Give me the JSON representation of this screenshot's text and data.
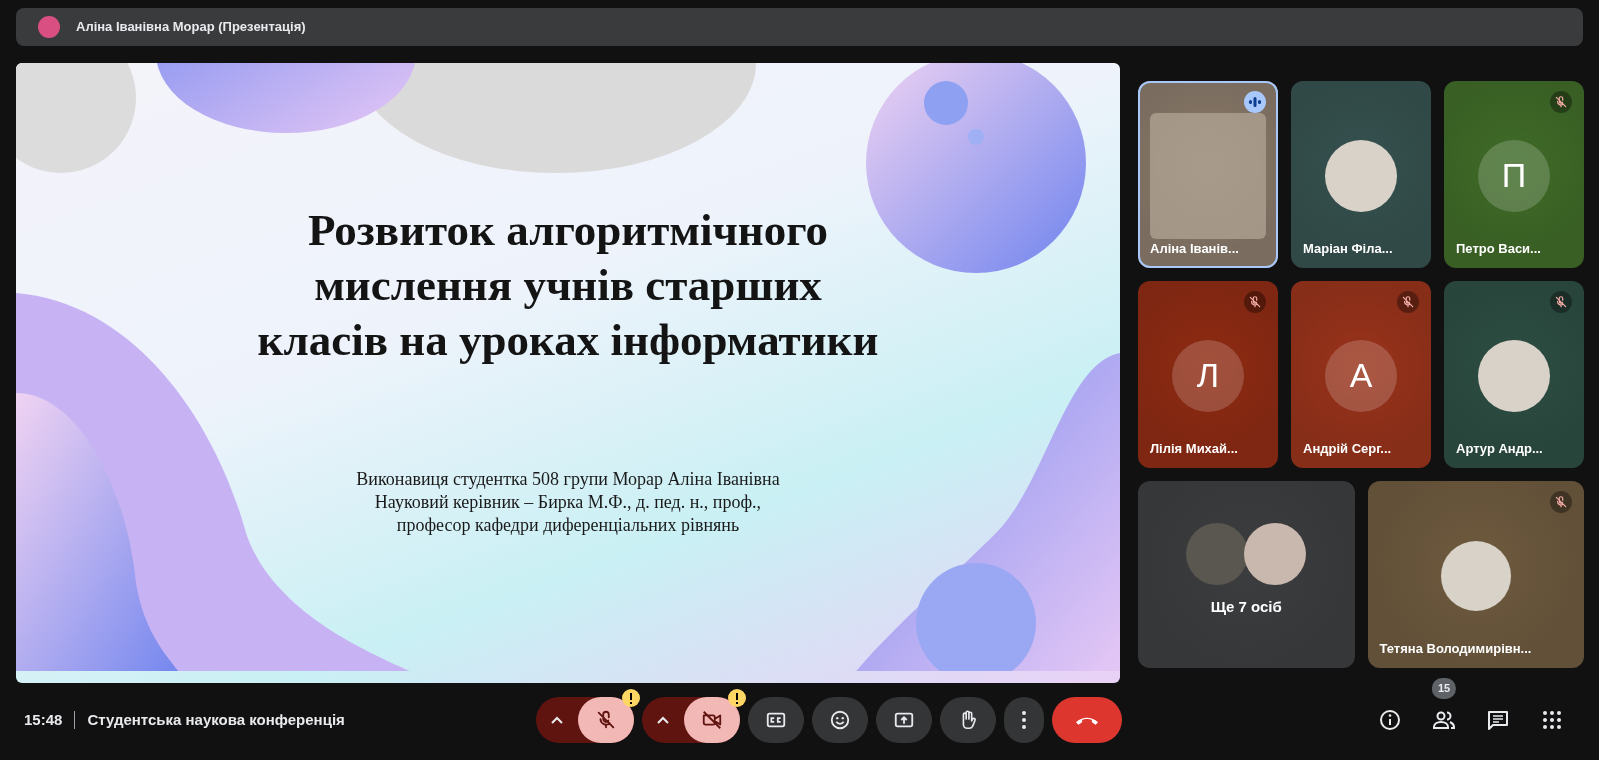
{
  "header": {
    "title": "Аліна Іванівна Морар (Презентація)"
  },
  "slide": {
    "title_lines": [
      "Розвиток алгоритмічного",
      "мислення учнів старших",
      "класів на уроках інформатики"
    ],
    "subtitle_lines": [
      "Виконавиця студентка 508 групи Морар Аліна Іванівна",
      "Науковий керівник – Бирка М.Ф., д. пед. н., проф.,",
      "професор кафедри диференціальних рівнянь"
    ]
  },
  "tiles": [
    {
      "kind": "video",
      "name": "Аліна Іванів...",
      "speaking": true,
      "muted": false,
      "color": "#8a7a6a"
    },
    {
      "kind": "photo",
      "name": "Маріан Філа...",
      "speaking": false,
      "muted": false,
      "color": "#35514f"
    },
    {
      "kind": "initial",
      "name": "Петро Васи...",
      "initial": "П",
      "speaking": false,
      "muted": true,
      "color": "#3f6b27"
    },
    {
      "kind": "initial",
      "name": "Лілія Михай...",
      "initial": "Л",
      "speaking": false,
      "muted": true,
      "color": "#8f2a12"
    },
    {
      "kind": "initial",
      "name": "Андрій Серг...",
      "initial": "А",
      "speaking": false,
      "muted": true,
      "color": "#99321a"
    },
    {
      "kind": "photo",
      "name": "Артур Андр...",
      "speaking": false,
      "muted": true,
      "color": "#2c4d42"
    },
    {
      "kind": "more",
      "name": "Ще 7 осіб",
      "speaking": false,
      "muted": false,
      "color": "#3c3d3f"
    },
    {
      "kind": "photo",
      "name": "Тетяна Володимирівн...",
      "speaking": false,
      "muted": true,
      "color": "#6e5a3e"
    }
  ],
  "footer": {
    "time": "15:48",
    "meeting": "Студентська наукова конференція"
  },
  "controls": [
    {
      "kind": "mic",
      "off": true,
      "warning": true
    },
    {
      "kind": "camera",
      "off": true,
      "warning": true
    },
    {
      "kind": "captions",
      "off": false,
      "warning": false
    },
    {
      "kind": "emoji",
      "off": false,
      "warning": false
    },
    {
      "kind": "present",
      "off": false,
      "warning": false
    },
    {
      "kind": "hand",
      "off": false,
      "warning": false
    },
    {
      "kind": "more",
      "off": false,
      "warning": false
    },
    {
      "kind": "end",
      "off": false,
      "warning": false
    }
  ],
  "side_buttons": [
    {
      "kind": "info"
    },
    {
      "kind": "people",
      "count": "15"
    },
    {
      "kind": "chat"
    },
    {
      "kind": "apps"
    }
  ]
}
